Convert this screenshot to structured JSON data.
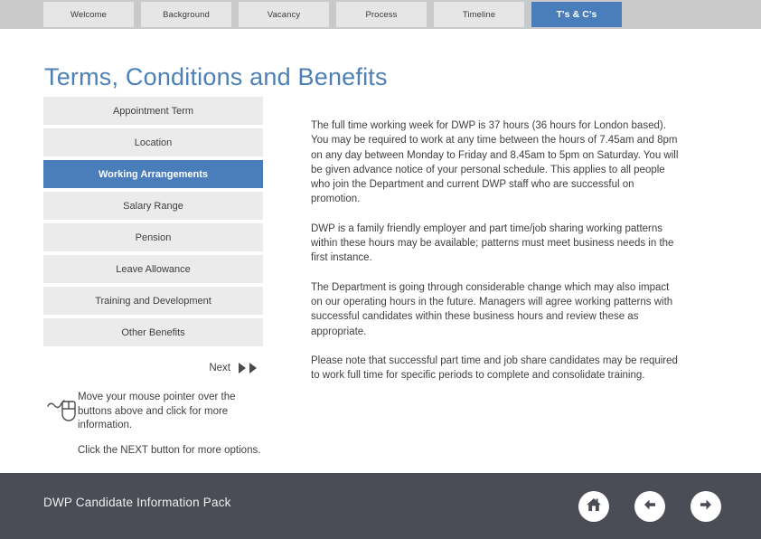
{
  "tabs": [
    {
      "label": "Welcome",
      "active": false
    },
    {
      "label": "Background",
      "active": false
    },
    {
      "label": "Vacancy",
      "active": false
    },
    {
      "label": "Process",
      "active": false
    },
    {
      "label": "Timeline",
      "active": false
    },
    {
      "label": "T's & C's",
      "active": true
    }
  ],
  "page": {
    "title": "Terms, Conditions and Benefits"
  },
  "sidebar": {
    "items": [
      {
        "label": "Appointment Term",
        "active": false
      },
      {
        "label": "Location",
        "active": false
      },
      {
        "label": "Working Arrangements",
        "active": true
      },
      {
        "label": "Salary Range",
        "active": false
      },
      {
        "label": "Pension",
        "active": false
      },
      {
        "label": "Leave Allowance",
        "active": false
      },
      {
        "label": "Training and Development",
        "active": false
      },
      {
        "label": "Other Benefits",
        "active": false
      }
    ]
  },
  "next": {
    "label": "Next",
    "icon": "double-chevron-right-icon"
  },
  "hint": {
    "icon": "mouse-icon",
    "line1": "Move your mouse pointer over the buttons above and click for more information.",
    "line2": "Click the NEXT button for more options."
  },
  "content": {
    "paragraphs": [
      "The full time working week for DWP is 37 hours (36 hours for London based). You may be required to work at any time between the hours of 7.45am and 8pm on any day between Monday to Friday and 8.45am to 5pm on Saturday. You will be given advance notice of your personal schedule. This applies to all people who join the Department and current DWP staff who are successful on promotion.",
      "DWP is a family friendly employer and part time/job sharing working patterns within these hours may be available; patterns must meet business needs in the first instance.",
      "The Department is going through considerable change which may also impact on our operating hours in the future. Managers will agree working patterns with successful candidates within these business hours and review these as appropriate.",
      "Please note that successful part time and job share candidates may be required to work full time for specific periods to complete and consolidate training."
    ]
  },
  "footer": {
    "title": "DWP Candidate Information Pack",
    "nav": [
      {
        "name": "home-icon"
      },
      {
        "name": "arrow-left-icon"
      },
      {
        "name": "arrow-right-icon"
      }
    ]
  },
  "colors": {
    "accent_blue": "#4a7ebb",
    "title_blue": "#4d80b6",
    "tabstrip_gray": "#c9c9c9",
    "button_gray": "#ebebeb",
    "footer_dark": "#4a4d55"
  }
}
